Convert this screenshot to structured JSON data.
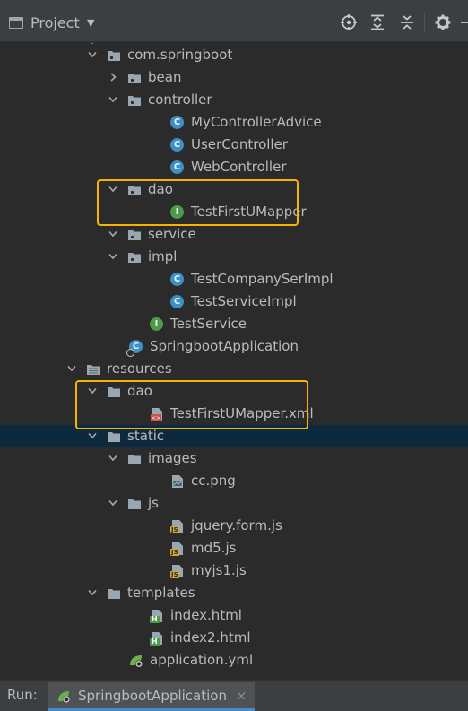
{
  "toolbar": {
    "title": "Project",
    "icons": [
      "project-icon",
      "dropdown-caret-icon",
      "locate-icon",
      "expand-all-icon",
      "collapse-all-icon",
      "gear-icon"
    ]
  },
  "tree": [
    {
      "label": "com.springboot",
      "icon": "package-folder-icon",
      "arrow": "down",
      "expanded": true
    },
    {
      "label": "bean",
      "icon": "package-folder-icon",
      "arrow": "right",
      "expanded": false
    },
    {
      "label": "controller",
      "icon": "package-folder-icon",
      "arrow": "down",
      "expanded": true
    },
    {
      "label": "MyControllerAdvice",
      "icon": "class-icon",
      "icon_letter": "C"
    },
    {
      "label": "UserController",
      "icon": "class-icon",
      "icon_letter": "C"
    },
    {
      "label": "WebController",
      "icon": "class-icon",
      "icon_letter": "C"
    },
    {
      "label": "dao",
      "icon": "package-folder-icon",
      "arrow": "down",
      "expanded": true
    },
    {
      "label": "TestFirstUMapper",
      "icon": "interface-icon",
      "icon_letter": "I"
    },
    {
      "label": "service",
      "icon": "package-folder-icon",
      "arrow": "down",
      "expanded": true
    },
    {
      "label": "impl",
      "icon": "package-folder-icon",
      "arrow": "down",
      "expanded": true
    },
    {
      "label": "TestCompanySerImpl",
      "icon": "class-icon",
      "icon_letter": "C"
    },
    {
      "label": "TestServiceImpl",
      "icon": "class-icon",
      "icon_letter": "C"
    },
    {
      "label": "TestService",
      "icon": "interface-icon",
      "icon_letter": "I"
    },
    {
      "label": "SpringbootApplication",
      "icon": "spring-boot-class-icon",
      "icon_letter": "C"
    },
    {
      "label": "resources",
      "icon": "resources-folder-icon",
      "arrow": "down",
      "expanded": true
    },
    {
      "label": "dao",
      "icon": "folder-icon",
      "arrow": "down",
      "expanded": true
    },
    {
      "label": "TestFirstUMapper.xml",
      "icon": "xml-file-icon"
    },
    {
      "label": "static",
      "icon": "folder-icon",
      "arrow": "down",
      "expanded": true,
      "selected": true
    },
    {
      "label": "images",
      "icon": "folder-icon",
      "arrow": "down",
      "expanded": true
    },
    {
      "label": "cc.png",
      "icon": "image-file-icon"
    },
    {
      "label": "js",
      "icon": "folder-icon",
      "arrow": "down",
      "expanded": true
    },
    {
      "label": "jquery.form.js",
      "icon": "js-file-icon",
      "icon_badge": "JS"
    },
    {
      "label": "md5.js",
      "icon": "js-file-icon",
      "icon_badge": "JS"
    },
    {
      "label": "myjs1.js",
      "icon": "js-file-icon",
      "icon_badge": "JS"
    },
    {
      "label": "templates",
      "icon": "folder-icon",
      "arrow": "down",
      "expanded": true
    },
    {
      "label": "index.html",
      "icon": "html-file-icon",
      "icon_badge": "H"
    },
    {
      "label": "index2.html",
      "icon": "html-file-icon",
      "icon_badge": "H"
    },
    {
      "label": "application.yml",
      "icon": "spring-config-file-icon"
    }
  ],
  "run_bar": {
    "label": "Run:",
    "tab_label": "SpringbootApplication",
    "close_glyph": "×"
  },
  "colors": {
    "background": "#2b2b2b",
    "toolbar": "#3c3f41",
    "text": "#bbbbbb",
    "selection": "#0d293e",
    "highlight_box": "#f5b400",
    "class_icon": "#3d8fc4",
    "interface_icon": "#4c9a4a"
  }
}
